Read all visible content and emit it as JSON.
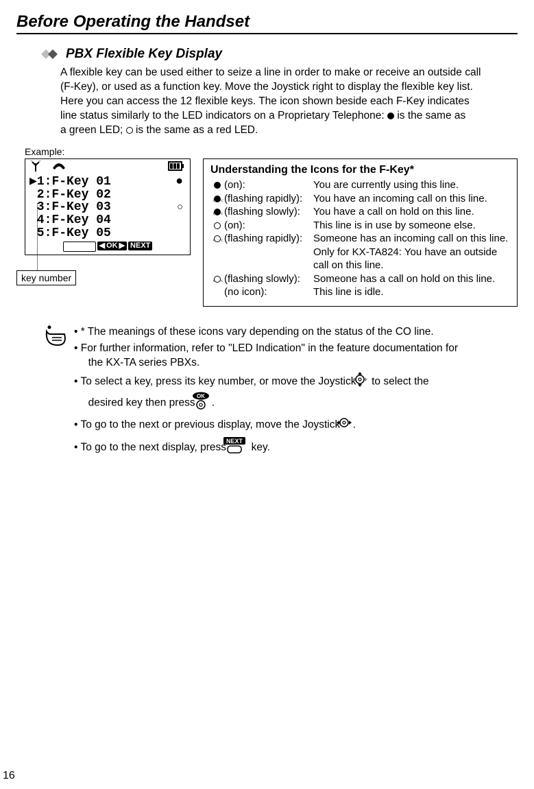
{
  "chapter_title": "Before Operating the Handset",
  "section_title": "PBX Flexible Key Display",
  "intro_l1": "A flexible key can be used either to seize a line in order to make or receive an outside call",
  "intro_l2": "(F-Key), or used as a function key. Move the Joystick right to display the flexible key list.",
  "intro_l3": "Here you can access the 12 flexible keys. The icon shown beside each F-Key indicates",
  "intro_l4_a": "line status similarly to the LED indicators on a Proprietary Telephone:  ",
  "intro_l4_b": "  is the same as",
  "intro_l5_a": "a green LED;  ",
  "intro_l5_b": "  is the same as a red LED.",
  "example_label": "Example:",
  "lcd": {
    "l1": "▶1:F-Key 01",
    "l2": " 2:F-Key 02",
    "l3": " 3:F-Key 03",
    "l4": " 4:F-Key 04",
    "l5": " 5:F-Key 05"
  },
  "softkey_ok": "OK",
  "softkey_next": "NEXT",
  "key_number_label": "key number",
  "understanding": {
    "title": "Understanding the Icons for the F-Key*",
    "r1s": "(on):",
    "r1d": "You are currently using this line.",
    "r2s": "(flashing rapidly):",
    "r2d": "You have an incoming call on this line.",
    "r3s": "(flashing slowly):",
    "r3d": "You have a call on hold on this line.",
    "r4s": "(on):",
    "r4d": "This line is in use by someone else.",
    "r5s": "(flashing rapidly):",
    "r5d": "Someone has an incoming call on this line.",
    "r5d2a": "Only for KX-TA824:",
    "r5d2b": "You have an outside",
    "r5d3": "call on this line.",
    "r6s": "(flashing slowly):",
    "r6d": "Someone has a call on hold on this line.",
    "r7s": "(no icon):",
    "r7d": "This line is idle."
  },
  "notes": {
    "n1": "* The meanings of these icons vary depending on the status of the CO line.",
    "n2a": "For further information, refer to \"LED Indication\" in the feature documentation for",
    "n2b": "the KX-TA series PBXs.",
    "n3a": "To select a key, press its key number, or move the Joystick ",
    "n3b": " to select the",
    "n3c": "desired key then press ",
    "n3d": ".",
    "n4a": "To go to the next or previous display, move the Joystick ",
    "n4b": ".",
    "n5a": "To go to the next display, press ",
    "n5b": " key."
  },
  "ok_label": "OK",
  "next_label": "NEXT",
  "page_number": "16"
}
